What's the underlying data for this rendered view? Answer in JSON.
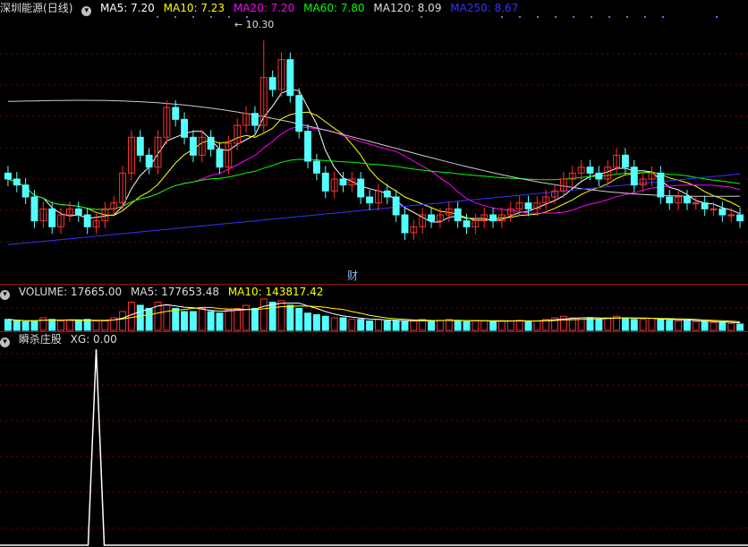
{
  "main": {
    "stock": "深圳能源",
    "period": "(日线)",
    "indicators": [
      {
        "label": "MA5: 7.20",
        "color": "#ffffff"
      },
      {
        "label": "MA10: 7.23",
        "color": "#ffff00"
      },
      {
        "label": "MA20: 7.20",
        "color": "#ff00ff"
      },
      {
        "label": "MA60: 7.80",
        "color": "#00ff00"
      },
      {
        "label": "MA120: 8.09",
        "color": "#dddddd"
      },
      {
        "label": "MA250: 8.67",
        "color": "#3333ff"
      }
    ],
    "high_label": "10.30",
    "marker": "财"
  },
  "volume": {
    "indicators": [
      {
        "label": "VOLUME: 17665.00",
        "color": "#dddddd"
      },
      {
        "label": "MA5: 177653.48",
        "color": "#dddddd"
      },
      {
        "label": "MA10: 143817.42",
        "color": "#ffff00"
      }
    ]
  },
  "signal": {
    "indicators": [
      {
        "label": "瞬杀庄股",
        "color": "#dddddd"
      },
      {
        "label": "XG: 0.00",
        "color": "#dddddd"
      }
    ]
  },
  "colors": {
    "up": "#ff3030",
    "down": "#54ffff",
    "grid": "#7a0000",
    "border": "#a01010"
  },
  "chart_data": [
    {
      "type": "candlestick",
      "description_note": "",
      "price_series_close": [
        7.9,
        7.8,
        7.6,
        7.2,
        7.4,
        7.1,
        7.3,
        7.4,
        7.3,
        7.1,
        7.2,
        7.4,
        7.5,
        8.0,
        8.6,
        8.3,
        8.1,
        8.6,
        9.1,
        8.9,
        8.6,
        8.3,
        8.6,
        8.4,
        8.1,
        8.5,
        8.8,
        9.0,
        8.8,
        9.6,
        9.4,
        9.9,
        9.3,
        8.7,
        8.2,
        8.0,
        7.7,
        7.9,
        7.8,
        7.9,
        7.6,
        7.5,
        7.7,
        7.6,
        7.3,
        7.0,
        7.1,
        7.3,
        7.2,
        7.3,
        7.4,
        7.2,
        7.1,
        7.2,
        7.3,
        7.2,
        7.3,
        7.4,
        7.5,
        7.4,
        7.5,
        7.6,
        7.7,
        7.9,
        8.0,
        8.1,
        8.0,
        7.9,
        8.1,
        8.3,
        8.1,
        7.8,
        7.9,
        8.0,
        7.6,
        7.5,
        7.6,
        7.5,
        7.5,
        7.4,
        7.4,
        7.3,
        7.3,
        7.2
      ],
      "ma_lines": [
        "MA5",
        "MA10",
        "MA20",
        "MA60",
        "MA120",
        "MA250"
      ],
      "high_annotation": 10.3
    },
    {
      "type": "bar",
      "series": [
        {
          "name": "VOLUME",
          "values": [
            0.35,
            0.3,
            0.28,
            0.3,
            0.4,
            0.35,
            0.3,
            0.32,
            0.3,
            0.35,
            0.3,
            0.3,
            0.4,
            0.6,
            0.9,
            0.8,
            0.7,
            0.9,
            0.8,
            0.7,
            0.6,
            0.6,
            0.7,
            0.6,
            0.55,
            0.65,
            0.7,
            0.8,
            0.7,
            1.0,
            0.9,
            0.95,
            0.8,
            0.7,
            0.55,
            0.5,
            0.45,
            0.4,
            0.4,
            0.35,
            0.35,
            0.3,
            0.35,
            0.3,
            0.3,
            0.28,
            0.3,
            0.35,
            0.3,
            0.32,
            0.35,
            0.3,
            0.28,
            0.3,
            0.3,
            0.28,
            0.3,
            0.3,
            0.32,
            0.3,
            0.3,
            0.35,
            0.4,
            0.45,
            0.4,
            0.4,
            0.38,
            0.35,
            0.4,
            0.45,
            0.4,
            0.35,
            0.35,
            0.38,
            0.35,
            0.32,
            0.3,
            0.3,
            0.28,
            0.28,
            0.25,
            0.25,
            0.22,
            0.2
          ]
        }
      ]
    },
    {
      "type": "line",
      "series": [
        {
          "name": "XG",
          "spike_index": 10
        }
      ]
    }
  ]
}
